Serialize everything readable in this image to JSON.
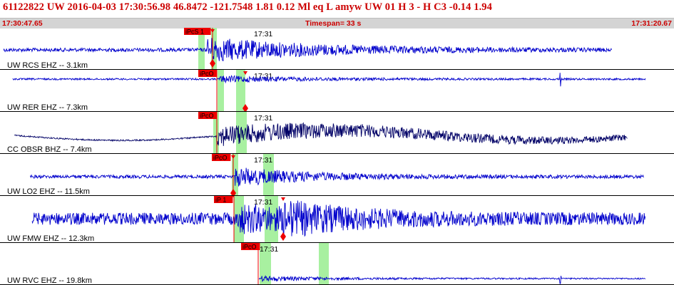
{
  "header": {
    "title": "61122822 UW 2016-04-03 17:30:56.98   46.8472 -121.7548   1.81  0.12 Ml  eq  L amyw     UW 01  H   3  -  H C3   -0.14  1.94",
    "start_time": "17:30:47.65",
    "timespan": "Timespan=  33 s",
    "end_time": "17:31:20.67"
  },
  "colors": {
    "trace": "#0000cc",
    "trace_dark": "#000066",
    "pick": "#ee0000",
    "window": "#a8f0a0",
    "header_text": "#cc0000"
  },
  "panels": [
    {
      "label": "UW RCS EHZ -- 3.1km",
      "picks": [
        {
          "text": "iPcS 1"
        }
      ],
      "time_label": "17:31"
    },
    {
      "label": "UW RER EHZ -- 7.3km",
      "picks": [
        {
          "text": "iPcO"
        }
      ],
      "time_label": "17:31"
    },
    {
      "label": "CC OBSR BHZ -- 7.4km",
      "picks": [
        {
          "text": "iPcO"
        }
      ],
      "time_label": "17:31"
    },
    {
      "label": "UW LO2 EHZ -- 11.5km",
      "picks": [
        {
          "text": "iPcO"
        }
      ],
      "time_label": "17:31"
    },
    {
      "label": "UW FMW EHZ -- 12.3km",
      "picks": [
        {
          "text": "iP 1"
        }
      ],
      "time_label": "17:31"
    },
    {
      "label": "UW RVC EHZ -- 19.8km",
      "picks": [
        {
          "text": "iPcO"
        }
      ],
      "time_label": "17:31"
    }
  ]
}
